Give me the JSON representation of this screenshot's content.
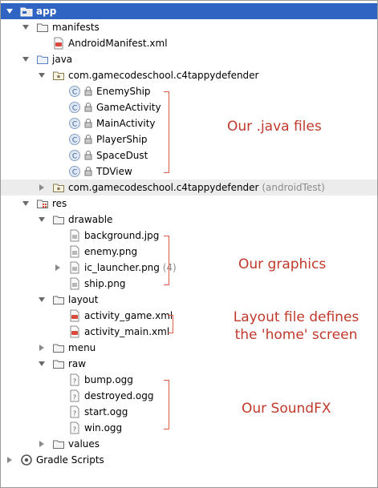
{
  "tree": {
    "app": "app",
    "manifests": "manifests",
    "android_manifest": "AndroidManifest.xml",
    "java": "java",
    "package_main": "com.gamecodeschool.c4tappydefender",
    "classes": [
      "EnemyShip",
      "GameActivity",
      "MainActivity",
      "PlayerShip",
      "SpaceDust",
      "TDView"
    ],
    "package_test": "com.gamecodeschool.c4tappydefender",
    "package_test_suffix": "(androidTest)",
    "res": "res",
    "drawable": "drawable",
    "drawables": [
      "background.jpg",
      "enemy.png",
      "ic_launcher.png",
      "ship.png"
    ],
    "ic_launcher_count": "(4)",
    "layout": "layout",
    "layouts": [
      "activity_game.xml",
      "activity_main.xml"
    ],
    "menu": "menu",
    "raw": "raw",
    "sounds": [
      "bump.ogg",
      "destroyed.ogg",
      "start.ogg",
      "win.ogg"
    ],
    "values": "values",
    "gradle": "Gradle Scripts"
  },
  "annotations": {
    "java_files": "Our .java files",
    "graphics": "Our graphics",
    "layout_line1": "Layout file defines",
    "layout_line2": "the 'home' screen",
    "sounds": "Our SoundFX"
  },
  "colors": {
    "selection": "#2f64c3",
    "annotation": "#c0392b",
    "bracket": "#e05a4a"
  }
}
